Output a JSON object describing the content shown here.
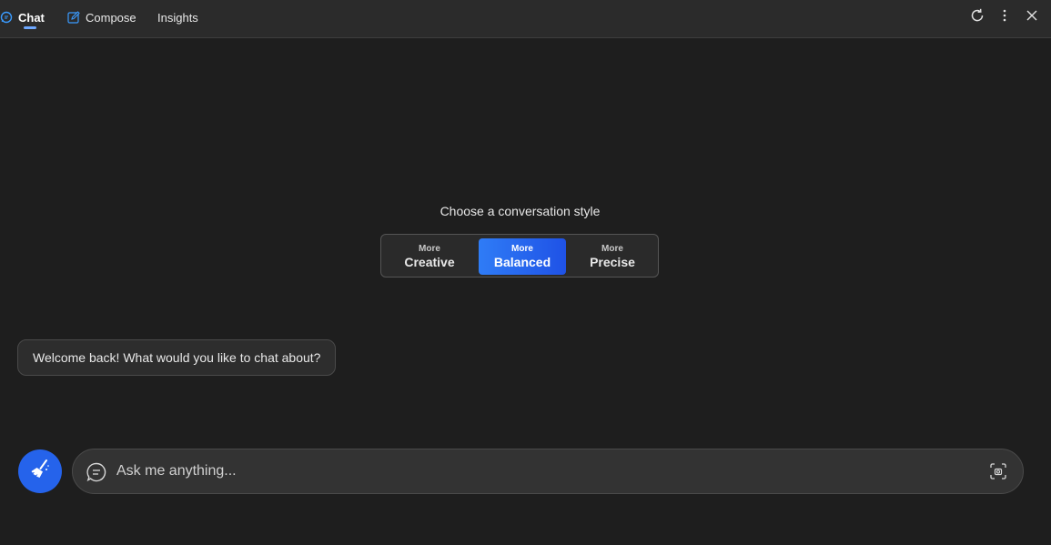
{
  "header": {
    "tabs": [
      {
        "label": "Chat",
        "icon": "chat-bubble-icon",
        "active": true
      },
      {
        "label": "Compose",
        "icon": "compose-edit-icon",
        "active": false
      },
      {
        "label": "Insights",
        "active": false
      }
    ],
    "actions": [
      "refresh-icon",
      "more-options-icon",
      "close-icon"
    ]
  },
  "style_picker": {
    "title": "Choose a conversation style",
    "options": [
      {
        "prefix": "More",
        "label": "Creative",
        "selected": false
      },
      {
        "prefix": "More",
        "label": "Balanced",
        "selected": true
      },
      {
        "prefix": "More",
        "label": "Precise",
        "selected": false
      }
    ]
  },
  "messages": [
    {
      "text": "Welcome back! What would you like to chat about?"
    }
  ],
  "composer": {
    "placeholder": "Ask me anything...",
    "new_topic_icon": "broom-icon",
    "left_icon": "chat-bubble-icon",
    "right_icon": "visual-search-icon"
  },
  "colors": {
    "accent": "#2563eb",
    "background": "#1e1e1e",
    "topbar": "#2b2b2b"
  }
}
